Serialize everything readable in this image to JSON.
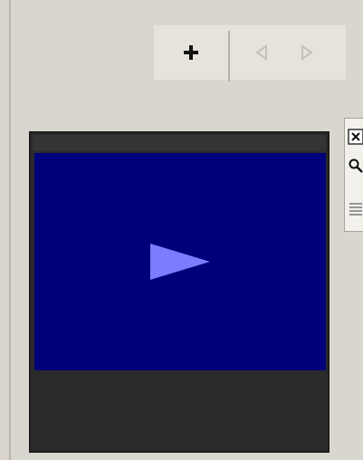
{
  "toolbar": {
    "buttons": [
      {
        "name": "add",
        "icon": "plus-icon"
      },
      {
        "name": "previous",
        "icon": "left-triangle-icon"
      },
      {
        "name": "next",
        "icon": "right-triangle-icon"
      }
    ]
  },
  "player": {
    "video_background": "#00007a",
    "play_icon_color": "#7b7cff",
    "icon": "play-icon"
  },
  "side_panel": {
    "icons": [
      "close-icon",
      "magnifier-icon",
      "list-icon"
    ]
  }
}
